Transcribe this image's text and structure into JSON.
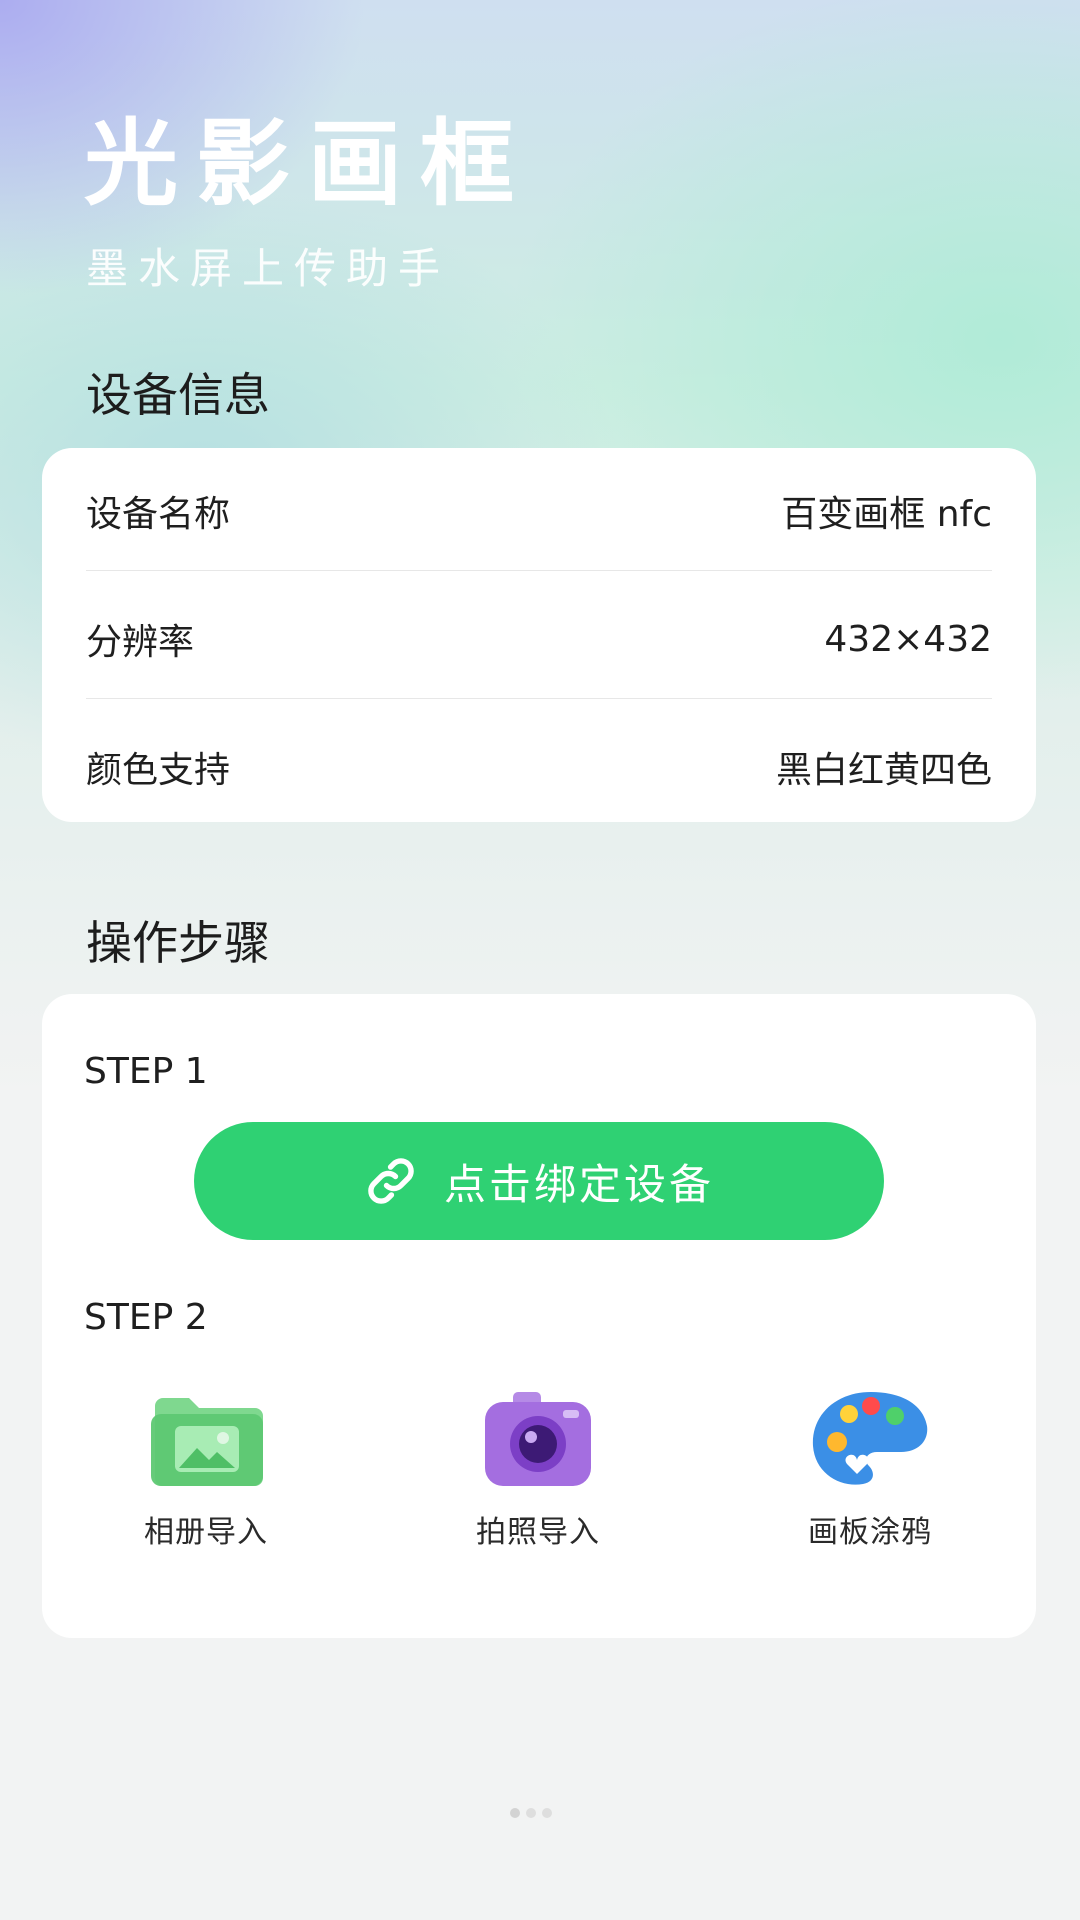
{
  "header": {
    "title": "光影画框",
    "subtitle": "墨水屏上传助手"
  },
  "device_info": {
    "section_title": "设备信息",
    "rows": [
      {
        "label": "设备名称",
        "value": "百变画框 nfc"
      },
      {
        "label": "分辨率",
        "value": "432×432"
      },
      {
        "label": "颜色支持",
        "value": "黑白红黄四色"
      }
    ]
  },
  "steps": {
    "section_title": "操作步骤",
    "step1_label": "STEP 1",
    "bind_button_label": "点击绑定设备",
    "step2_label": "STEP 2",
    "actions": [
      {
        "label": "相册导入",
        "icon": "photo-album-icon"
      },
      {
        "label": "拍照导入",
        "icon": "camera-icon"
      },
      {
        "label": "画板涂鸦",
        "icon": "paint-palette-icon"
      }
    ]
  },
  "colors": {
    "accent": "#2fd173",
    "card_bg": "#ffffff",
    "page_bg": "#f2f3f3"
  },
  "pager": {
    "count": 3,
    "active_index": 0
  }
}
